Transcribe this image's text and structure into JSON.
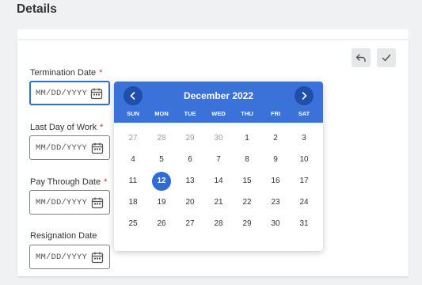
{
  "page": {
    "title": "Details"
  },
  "actions": {
    "undo_icon": "undo-arrow-icon",
    "confirm_icon": "checkmark-icon"
  },
  "fields": [
    {
      "label": "Termination Date",
      "required": true,
      "placeholder": "MM/DD/YYYY",
      "focused": true
    },
    {
      "label": "Last Day of Work",
      "required": true,
      "placeholder": "MM/DD/YYYY",
      "focused": false
    },
    {
      "label": "Pay Through Date",
      "required": true,
      "placeholder": "MM/DD/YYYY",
      "focused": false
    },
    {
      "label": "Resignation Date",
      "required": false,
      "placeholder": "MM/DD/YYYY",
      "focused": false
    }
  ],
  "calendar": {
    "month_label": "December 2022",
    "days_of_week": [
      "SUN",
      "MON",
      "TUE",
      "WED",
      "THU",
      "FRI",
      "SAT"
    ],
    "selected_day": "12",
    "weeks": [
      [
        {
          "d": "27",
          "muted": true
        },
        {
          "d": "28",
          "muted": true
        },
        {
          "d": "29",
          "muted": true
        },
        {
          "d": "30",
          "muted": true
        },
        {
          "d": "1"
        },
        {
          "d": "2"
        },
        {
          "d": "3"
        }
      ],
      [
        {
          "d": "4"
        },
        {
          "d": "5"
        },
        {
          "d": "6"
        },
        {
          "d": "7"
        },
        {
          "d": "8"
        },
        {
          "d": "9"
        },
        {
          "d": "10"
        }
      ],
      [
        {
          "d": "11"
        },
        {
          "d": "12",
          "selected": true
        },
        {
          "d": "13"
        },
        {
          "d": "14"
        },
        {
          "d": "15"
        },
        {
          "d": "16"
        },
        {
          "d": "17"
        }
      ],
      [
        {
          "d": "18"
        },
        {
          "d": "19"
        },
        {
          "d": "20"
        },
        {
          "d": "21"
        },
        {
          "d": "22"
        },
        {
          "d": "23"
        },
        {
          "d": "24"
        }
      ],
      [
        {
          "d": "25"
        },
        {
          "d": "26"
        },
        {
          "d": "27"
        },
        {
          "d": "28"
        },
        {
          "d": "29"
        },
        {
          "d": "30"
        },
        {
          "d": "31"
        }
      ]
    ]
  },
  "colors": {
    "accent": "#3b72d9",
    "required": "#de2f2f",
    "selected": "#2e6bd4"
  },
  "req_marker": "*"
}
